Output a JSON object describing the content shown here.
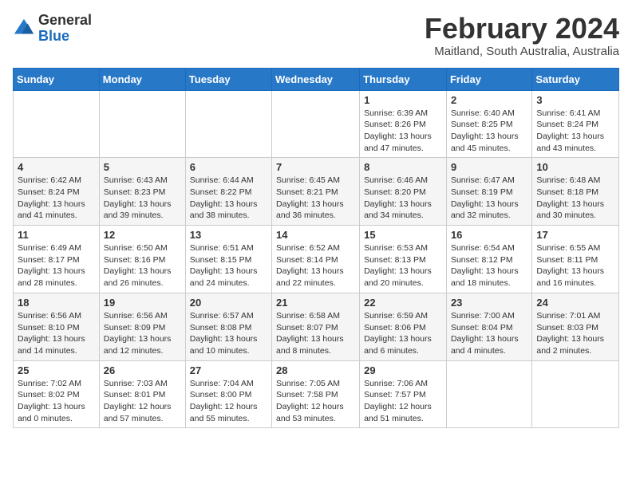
{
  "logo": {
    "general": "General",
    "blue": "Blue"
  },
  "header": {
    "month": "February 2024",
    "location": "Maitland, South Australia, Australia"
  },
  "days_of_week": [
    "Sunday",
    "Monday",
    "Tuesday",
    "Wednesday",
    "Thursday",
    "Friday",
    "Saturday"
  ],
  "weeks": [
    [
      {
        "day": "",
        "info": ""
      },
      {
        "day": "",
        "info": ""
      },
      {
        "day": "",
        "info": ""
      },
      {
        "day": "",
        "info": ""
      },
      {
        "day": "1",
        "info": "Sunrise: 6:39 AM\nSunset: 8:26 PM\nDaylight: 13 hours and 47 minutes."
      },
      {
        "day": "2",
        "info": "Sunrise: 6:40 AM\nSunset: 8:25 PM\nDaylight: 13 hours and 45 minutes."
      },
      {
        "day": "3",
        "info": "Sunrise: 6:41 AM\nSunset: 8:24 PM\nDaylight: 13 hours and 43 minutes."
      }
    ],
    [
      {
        "day": "4",
        "info": "Sunrise: 6:42 AM\nSunset: 8:24 PM\nDaylight: 13 hours and 41 minutes."
      },
      {
        "day": "5",
        "info": "Sunrise: 6:43 AM\nSunset: 8:23 PM\nDaylight: 13 hours and 39 minutes."
      },
      {
        "day": "6",
        "info": "Sunrise: 6:44 AM\nSunset: 8:22 PM\nDaylight: 13 hours and 38 minutes."
      },
      {
        "day": "7",
        "info": "Sunrise: 6:45 AM\nSunset: 8:21 PM\nDaylight: 13 hours and 36 minutes."
      },
      {
        "day": "8",
        "info": "Sunrise: 6:46 AM\nSunset: 8:20 PM\nDaylight: 13 hours and 34 minutes."
      },
      {
        "day": "9",
        "info": "Sunrise: 6:47 AM\nSunset: 8:19 PM\nDaylight: 13 hours and 32 minutes."
      },
      {
        "day": "10",
        "info": "Sunrise: 6:48 AM\nSunset: 8:18 PM\nDaylight: 13 hours and 30 minutes."
      }
    ],
    [
      {
        "day": "11",
        "info": "Sunrise: 6:49 AM\nSunset: 8:17 PM\nDaylight: 13 hours and 28 minutes."
      },
      {
        "day": "12",
        "info": "Sunrise: 6:50 AM\nSunset: 8:16 PM\nDaylight: 13 hours and 26 minutes."
      },
      {
        "day": "13",
        "info": "Sunrise: 6:51 AM\nSunset: 8:15 PM\nDaylight: 13 hours and 24 minutes."
      },
      {
        "day": "14",
        "info": "Sunrise: 6:52 AM\nSunset: 8:14 PM\nDaylight: 13 hours and 22 minutes."
      },
      {
        "day": "15",
        "info": "Sunrise: 6:53 AM\nSunset: 8:13 PM\nDaylight: 13 hours and 20 minutes."
      },
      {
        "day": "16",
        "info": "Sunrise: 6:54 AM\nSunset: 8:12 PM\nDaylight: 13 hours and 18 minutes."
      },
      {
        "day": "17",
        "info": "Sunrise: 6:55 AM\nSunset: 8:11 PM\nDaylight: 13 hours and 16 minutes."
      }
    ],
    [
      {
        "day": "18",
        "info": "Sunrise: 6:56 AM\nSunset: 8:10 PM\nDaylight: 13 hours and 14 minutes."
      },
      {
        "day": "19",
        "info": "Sunrise: 6:56 AM\nSunset: 8:09 PM\nDaylight: 13 hours and 12 minutes."
      },
      {
        "day": "20",
        "info": "Sunrise: 6:57 AM\nSunset: 8:08 PM\nDaylight: 13 hours and 10 minutes."
      },
      {
        "day": "21",
        "info": "Sunrise: 6:58 AM\nSunset: 8:07 PM\nDaylight: 13 hours and 8 minutes."
      },
      {
        "day": "22",
        "info": "Sunrise: 6:59 AM\nSunset: 8:06 PM\nDaylight: 13 hours and 6 minutes."
      },
      {
        "day": "23",
        "info": "Sunrise: 7:00 AM\nSunset: 8:04 PM\nDaylight: 13 hours and 4 minutes."
      },
      {
        "day": "24",
        "info": "Sunrise: 7:01 AM\nSunset: 8:03 PM\nDaylight: 13 hours and 2 minutes."
      }
    ],
    [
      {
        "day": "25",
        "info": "Sunrise: 7:02 AM\nSunset: 8:02 PM\nDaylight: 13 hours and 0 minutes."
      },
      {
        "day": "26",
        "info": "Sunrise: 7:03 AM\nSunset: 8:01 PM\nDaylight: 12 hours and 57 minutes."
      },
      {
        "day": "27",
        "info": "Sunrise: 7:04 AM\nSunset: 8:00 PM\nDaylight: 12 hours and 55 minutes."
      },
      {
        "day": "28",
        "info": "Sunrise: 7:05 AM\nSunset: 7:58 PM\nDaylight: 12 hours and 53 minutes."
      },
      {
        "day": "29",
        "info": "Sunrise: 7:06 AM\nSunset: 7:57 PM\nDaylight: 12 hours and 51 minutes."
      },
      {
        "day": "",
        "info": ""
      },
      {
        "day": "",
        "info": ""
      }
    ]
  ]
}
